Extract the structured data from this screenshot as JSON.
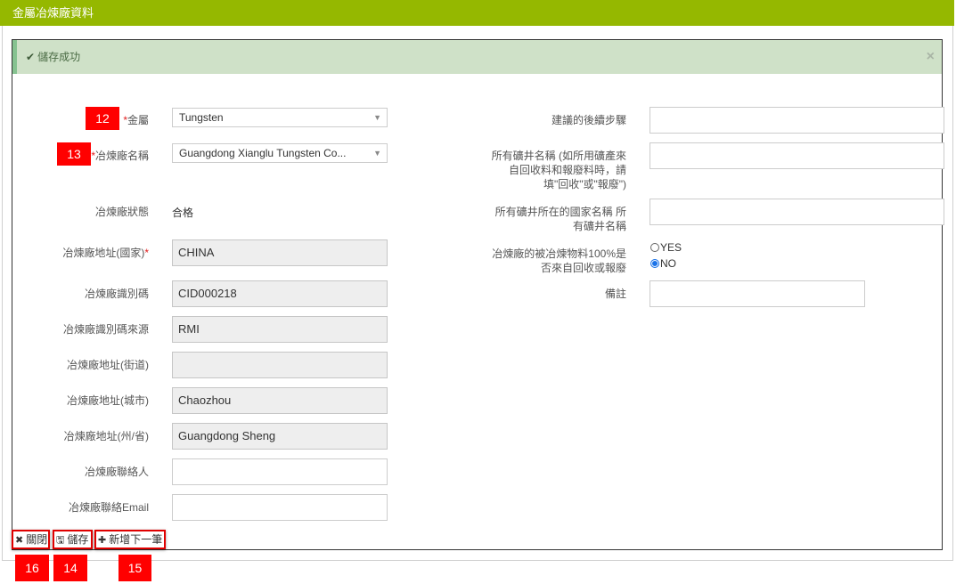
{
  "header": {
    "title": "金屬冶煉廠資料"
  },
  "alert": {
    "icon": "check-icon",
    "message": "儲存成功",
    "close_icon": "close-icon"
  },
  "left_form": {
    "metal": {
      "label": "金屬",
      "required": "*",
      "value": "Tungsten",
      "badge": "12"
    },
    "smelter_name": {
      "label": "冶煉廠名稱",
      "required": "*",
      "value": "Guangdong Xianglu Tungsten Co...",
      "badge": "13"
    },
    "smelter_status": {
      "label": "冶煉廠狀態",
      "value": "合格"
    },
    "country": {
      "label": "冶煉廠地址(國家)",
      "required": "*",
      "value": "CHINA"
    },
    "smelter_id": {
      "label": "冶煉廠識別碼",
      "value": "CID000218"
    },
    "id_source": {
      "label": "冶煉廠識別碼來源",
      "value": "RMI"
    },
    "street": {
      "label": "冶煉廠地址(街道)",
      "value": ""
    },
    "city": {
      "label": "冶煉廠地址(城市)",
      "value": "Chaozhou"
    },
    "province": {
      "label": "冶煉廠地址(州/省)",
      "value": "Guangdong Sheng"
    },
    "contact": {
      "label": "冶煉廠聯絡人",
      "value": ""
    },
    "contact_email": {
      "label": "冶煉廠聯絡Email",
      "value": ""
    }
  },
  "right_form": {
    "next_steps": {
      "label": "建議的後續步驟",
      "value": ""
    },
    "mine_names": {
      "label_line1": "所有礦井名稱 (如所用礦產來",
      "label_line2": "自回收料和報廢料時，請",
      "label_line3": "填\"回收\"或\"報廢\")",
      "value": ""
    },
    "mine_country": {
      "label_line1": "所有礦井所在的國家名稱 所",
      "label_line2": "有礦井名稱",
      "value": ""
    },
    "recycled": {
      "label_line1": "冶煉廠的被冶煉物料100%是",
      "label_line2": "否來自回收或報廢",
      "options": [
        {
          "label": "YES",
          "checked": false
        },
        {
          "label": "NO",
          "checked": true
        }
      ]
    },
    "remarks": {
      "label": "備註",
      "value": ""
    }
  },
  "buttons": {
    "close": {
      "label": "關閉",
      "icon": "close-icon",
      "badge": "16"
    },
    "save": {
      "label": "儲存",
      "icon": "save-icon",
      "badge": "14"
    },
    "add_next": {
      "label": "新增下一筆",
      "icon": "plus-icon",
      "badge": "15"
    }
  }
}
